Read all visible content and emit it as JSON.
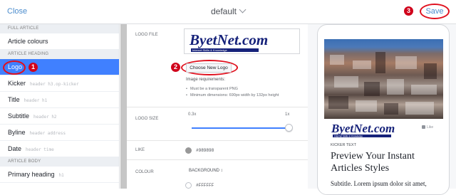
{
  "topbar": {
    "close_label": "Close",
    "title": "default",
    "save_label": "Save",
    "badge_save": "3"
  },
  "sidebar": {
    "sections": [
      {
        "heading": "FULL ARTICLE",
        "items": [
          {
            "label": "Article colours",
            "selector": ""
          }
        ]
      },
      {
        "heading": "ARTICLE HEADING",
        "items": [
          {
            "label": "Logo",
            "selector": ""
          },
          {
            "label": "Kicker",
            "selector": "header h3.op-kicker"
          },
          {
            "label": "Title",
            "selector": "header h1"
          },
          {
            "label": "Subtitle",
            "selector": "header h2"
          },
          {
            "label": "Byline",
            "selector": "header address"
          },
          {
            "label": "Date",
            "selector": "header time"
          }
        ]
      },
      {
        "heading": "ARTICLE BODY",
        "items": [
          {
            "label": "Primary heading",
            "selector": "h1"
          }
        ]
      }
    ],
    "badge_logo": "1"
  },
  "middle": {
    "logo_file_label": "LOGO FILE",
    "logo_text": "ByetNet.com",
    "logo_tagline": "Internet Skills & Knowledge",
    "choose_label": "Choose New Logo",
    "badge_choose": "2",
    "requirements_heading": "Image requirements:",
    "requirements": [
      "Must be a transparent PNG",
      "Minimum dimensions: 690px width by 132px height"
    ],
    "logo_size_label": "LOGO SIZE",
    "slider_min": "0.3x",
    "slider_max": "1x",
    "slider_value": 1,
    "like_label": "LIKE",
    "like_color": "#989898",
    "colour_label": "COLOUR",
    "background_label": "BACKGROUND ↕",
    "background_color": "#FFFFFF"
  },
  "preview": {
    "brand": "ByetNet.com",
    "brand_tagline": "Internet Skills & Knowledge",
    "like": "Like",
    "kicker": "KICKER TEXT",
    "headline": "Preview Your Instant Articles Styles",
    "subtitle": "Subtitle. Lorem ipsum dolor sit amet,"
  },
  "colors": {
    "accent": "#4080ff",
    "link": "#4b8ccd",
    "annotation": "#e0101e",
    "badge": "#d0021b"
  }
}
